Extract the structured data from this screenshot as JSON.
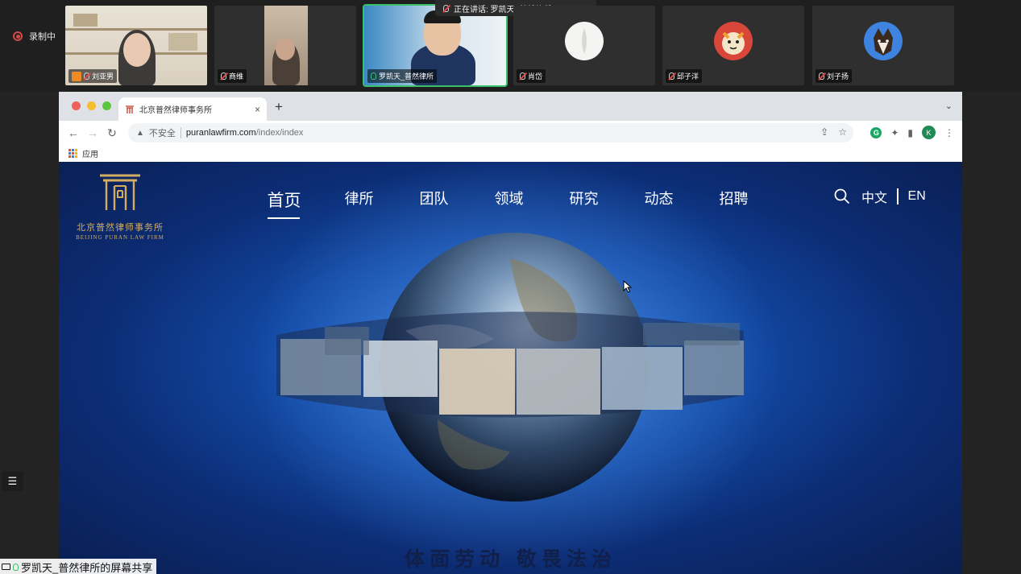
{
  "meeting": {
    "recording_label": "录制中",
    "speaking_banner": "正在讲话: 罗凯天_普然律所;",
    "participants": [
      {
        "name": "刘亚男"
      },
      {
        "name": "商维"
      },
      {
        "name": "罗凯天_普然律所"
      },
      {
        "name": "肖岱"
      },
      {
        "name": "邱子洋"
      },
      {
        "name": "刘子扬"
      }
    ],
    "share_label": "罗凯天_普然律所的屏幕共享"
  },
  "browser": {
    "tab_title": "北京普然律师事务所",
    "tab_close": "×",
    "new_tab": "+",
    "insecure_label": "不安全",
    "url_host": "puranlawfirm.com",
    "url_path": "/index/index",
    "profile_initial": "K",
    "bookmark_apps": "应用"
  },
  "site": {
    "logo_cn": "北京普然律师事务所",
    "logo_en": "BEIJING PURAN LAW FIRM",
    "nav": [
      {
        "label": "首页",
        "active": true
      },
      {
        "label": "律所"
      },
      {
        "label": "团队"
      },
      {
        "label": "领域"
      },
      {
        "label": "研究"
      },
      {
        "label": "动态"
      },
      {
        "label": "招聘"
      }
    ],
    "lang_zh": "中文",
    "lang_en": "EN",
    "slogan": "体面劳动 敬畏法治"
  },
  "colors": {
    "speaking_border": "#3bbf6a",
    "logo_gold": "#d4ad62",
    "site_blue": "#124aa6",
    "record_red": "#d14a4a"
  }
}
